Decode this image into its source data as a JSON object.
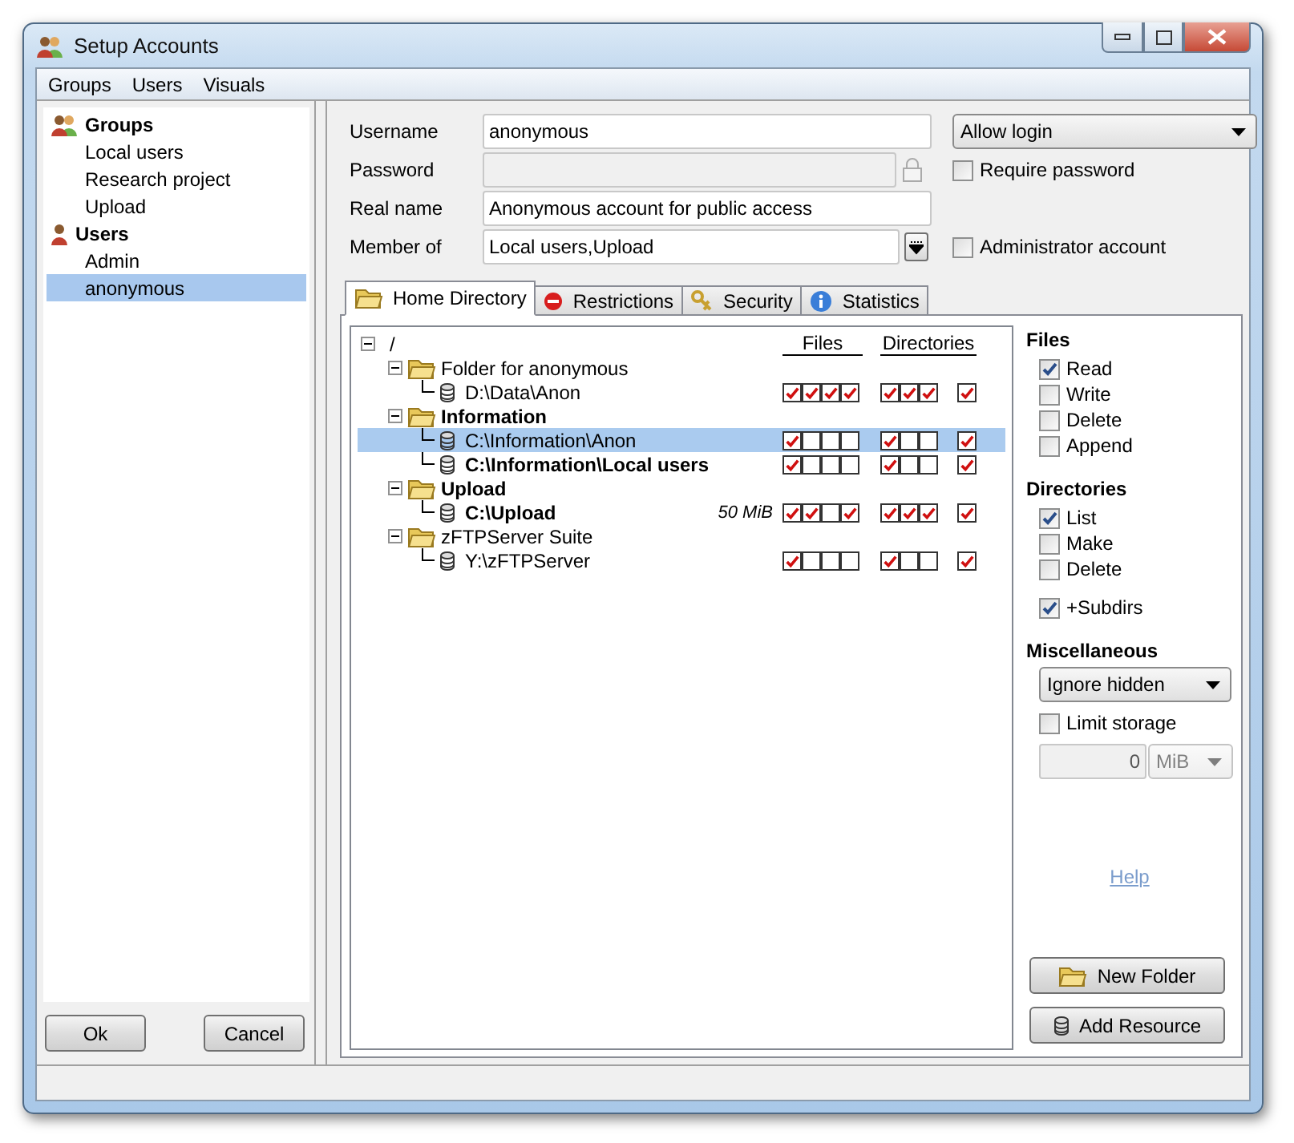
{
  "window": {
    "title": "Setup Accounts"
  },
  "menu": [
    "Groups",
    "Users",
    "Visuals"
  ],
  "sidebar": {
    "sections": [
      {
        "label": "Groups",
        "kind": "groups",
        "items": [
          {
            "label": "Local users",
            "selected": false
          },
          {
            "label": "Research project",
            "selected": false
          },
          {
            "label": "Upload",
            "selected": false
          }
        ]
      },
      {
        "label": "Users",
        "kind": "user",
        "items": [
          {
            "label": "Admin",
            "selected": false
          },
          {
            "label": "anonymous",
            "selected": true
          }
        ]
      }
    ]
  },
  "form": {
    "username": {
      "label": "Username",
      "value": "anonymous"
    },
    "password": {
      "label": "Password",
      "disabled": true
    },
    "real_name": {
      "label": "Real name",
      "value": "Anonymous account for public access"
    },
    "member_of": {
      "label": "Member of",
      "value": "Local users,Upload"
    },
    "login_mode": "Allow login",
    "require_password": {
      "label": "Require password",
      "checked": false
    },
    "administrator": {
      "label": "Administrator account",
      "checked": false
    }
  },
  "tabs": [
    {
      "label": "Home Directory",
      "kind": "folder",
      "selected": true
    },
    {
      "label": "Restrictions",
      "kind": "stop",
      "selected": false
    },
    {
      "label": "Security",
      "kind": "keys",
      "selected": false
    },
    {
      "label": "Statistics",
      "kind": "info",
      "selected": false
    }
  ],
  "tree": {
    "root": "/",
    "expanded": true,
    "columns": [
      "Files",
      "Directories"
    ],
    "children": [
      {
        "label": "Folder for anonymous",
        "bold": false,
        "expanded": true,
        "children": [
          {
            "label": "D:\\Data\\Anon",
            "bold": false,
            "selected": false,
            "files": [
              true,
              true,
              true,
              true
            ],
            "dirs": [
              true,
              true,
              true
            ],
            "subdirs": true
          }
        ]
      },
      {
        "label": "Information",
        "bold": true,
        "expanded": true,
        "children": [
          {
            "label": "C:\\Information\\Anon",
            "bold": false,
            "selected": true,
            "files": [
              true,
              false,
              false,
              false
            ],
            "dirs": [
              true,
              false,
              false
            ],
            "subdirs": true
          },
          {
            "label": "C:\\Information\\Local users",
            "bold": true,
            "selected": false,
            "files": [
              true,
              false,
              false,
              false
            ],
            "dirs": [
              true,
              false,
              false
            ],
            "subdirs": true
          }
        ]
      },
      {
        "label": "Upload",
        "bold": true,
        "expanded": true,
        "children": [
          {
            "label": "C:\\Upload",
            "bold": true,
            "selected": false,
            "quota": "50 MiB",
            "files": [
              true,
              true,
              false,
              true
            ],
            "dirs": [
              true,
              true,
              true
            ],
            "subdirs": true
          }
        ]
      },
      {
        "label": "zFTPServer Suite",
        "bold": false,
        "expanded": true,
        "children": [
          {
            "label": "Y:\\zFTPServer",
            "bold": false,
            "selected": false,
            "files": [
              true,
              false,
              false,
              false
            ],
            "dirs": [
              true,
              false,
              false
            ],
            "subdirs": true
          }
        ]
      }
    ]
  },
  "permissions": {
    "files": {
      "title": "Files",
      "options": [
        {
          "label": "Read",
          "checked": true
        },
        {
          "label": "Write",
          "checked": false
        },
        {
          "label": "Delete",
          "checked": false
        },
        {
          "label": "Append",
          "checked": false
        }
      ]
    },
    "directories": {
      "title": "Directories",
      "options": [
        {
          "label": "List",
          "checked": true
        },
        {
          "label": "Make",
          "checked": false
        },
        {
          "label": "Delete",
          "checked": false
        }
      ]
    },
    "subdirs": {
      "label": "+Subdirs",
      "checked": true
    },
    "misc": {
      "title": "Miscellaneous",
      "hidden_mode": "Ignore hidden",
      "limit_storage": {
        "label": "Limit storage",
        "checked": false
      },
      "storage_value": "0",
      "storage_unit": "MiB"
    }
  },
  "help_link": "Help",
  "actions": [
    "New Folder",
    "Add Resource"
  ],
  "buttons": [
    "Ok",
    "Cancel"
  ]
}
